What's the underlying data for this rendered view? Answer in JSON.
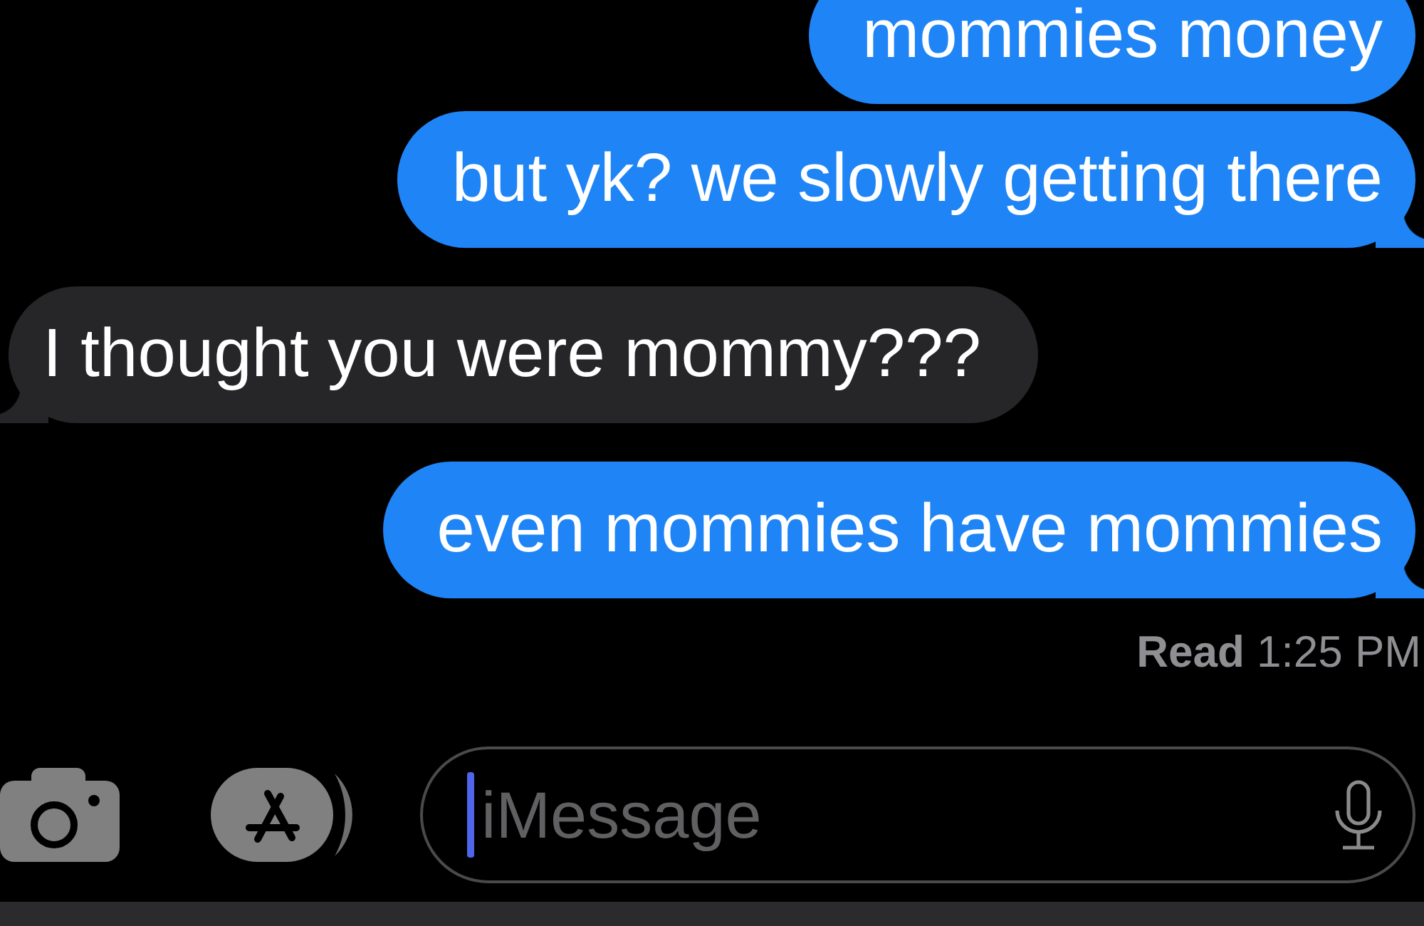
{
  "messages": [
    {
      "kind": "sent",
      "text": "mommies money"
    },
    {
      "kind": "sent",
      "text": "but yk? we slowly getting there"
    },
    {
      "kind": "received",
      "text": "I thought you were mommy???"
    },
    {
      "kind": "sent",
      "text": "even mommies have mommies"
    }
  ],
  "read_receipt": "**Read** 1:25 PM",
  "composer": {
    "placeholder": "iMessage",
    "focused": true
  }
}
